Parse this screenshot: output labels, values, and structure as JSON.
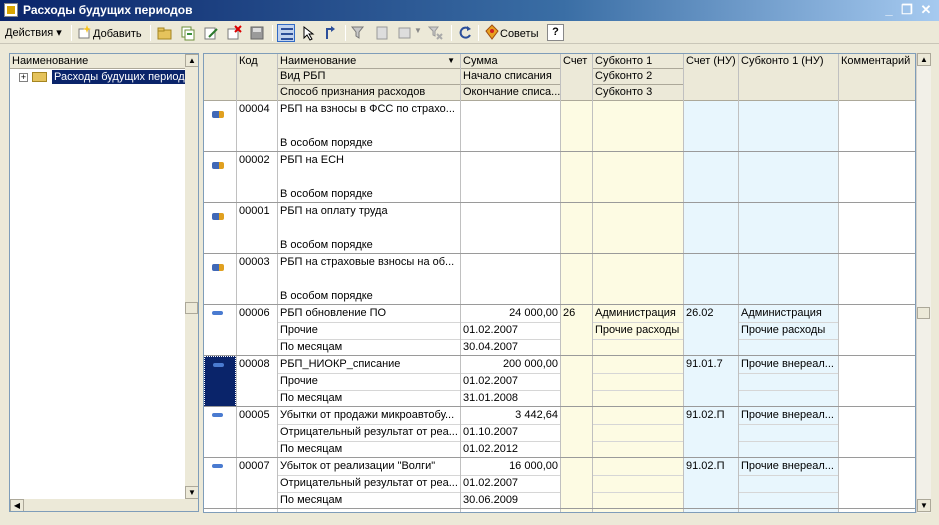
{
  "window": {
    "title": "Расходы будущих периодов"
  },
  "toolbar": {
    "actions_label": "Действия",
    "add_label": "Добавить",
    "tips_label": "Советы",
    "help_label": "?"
  },
  "tree": {
    "header": "Наименование",
    "root_label": "Расходы будущих период"
  },
  "grid": {
    "headers": {
      "code": "Код",
      "name": "Наименование",
      "kind": "Вид РБП",
      "method": "Способ признания расходов",
      "sum": "Сумма",
      "start": "Начало списания",
      "end": "Окончание списа...",
      "account": "Счет",
      "subconto1": "Субконто 1",
      "subconto2": "Субконто 2",
      "subconto3": "Субконто 3",
      "account_nu": "Счет (НУ)",
      "subconto1_nu": "Субконто 1 (НУ)",
      "comment": "Комментарий"
    },
    "rows": [
      {
        "type": "folder",
        "code": "00004",
        "name": "РБП на взносы в ФСС по страхо...",
        "kind": "",
        "method": "В особом порядке",
        "sum": "",
        "start": "",
        "end": "",
        "account": "",
        "sub1": "",
        "sub2": "",
        "acc_nu": "",
        "sub1_nu": "",
        "sub2_nu": "",
        "comment": ""
      },
      {
        "type": "folder",
        "code": "00002",
        "name": "РБП на ЕСН",
        "kind": "",
        "method": "В особом порядке",
        "sum": "",
        "start": "",
        "end": "",
        "account": "",
        "sub1": "",
        "sub2": "",
        "acc_nu": "",
        "sub1_nu": "",
        "sub2_nu": "",
        "comment": ""
      },
      {
        "type": "folder",
        "code": "00001",
        "name": "РБП на оплату труда",
        "kind": "",
        "method": "В особом порядке",
        "sum": "",
        "start": "",
        "end": "",
        "account": "",
        "sub1": "",
        "sub2": "",
        "acc_nu": "",
        "sub1_nu": "",
        "sub2_nu": "",
        "comment": ""
      },
      {
        "type": "folder",
        "code": "00003",
        "name": "РБП на страховые взносы на об...",
        "kind": "",
        "method": "В особом порядке",
        "sum": "",
        "start": "",
        "end": "",
        "account": "",
        "sub1": "",
        "sub2": "",
        "acc_nu": "",
        "sub1_nu": "",
        "sub2_nu": "",
        "comment": ""
      },
      {
        "type": "item",
        "code": "00006",
        "name": "РБП обновление ПО",
        "kind": "Прочие",
        "method": "По месяцам",
        "sum": "24 000,00",
        "start": "01.02.2007",
        "end": "30.04.2007",
        "account": "26",
        "sub1": "Администрация",
        "sub2": "Прочие расходы",
        "acc_nu": "26.02",
        "sub1_nu": "Администрация",
        "sub2_nu": "Прочие расходы",
        "comment": ""
      },
      {
        "type": "item",
        "code": "00008",
        "name": "РБП_НИОКР_списание",
        "kind": "Прочие",
        "method": "По месяцам",
        "sum": "200 000,00",
        "start": "01.02.2007",
        "end": "31.01.2008",
        "account": "",
        "sub1": "",
        "sub2": "",
        "acc_nu": "91.01.7",
        "sub1_nu": "Прочие внереал...",
        "sub2_nu": "",
        "comment": "",
        "selected": true
      },
      {
        "type": "item",
        "code": "00005",
        "name": "Убытки от продажи микроавтобу...",
        "kind": "Отрицательный результат от реа...",
        "method": "По месяцам",
        "sum": "3 442,64",
        "start": "01.10.2007",
        "end": "01.02.2012",
        "account": "",
        "sub1": "",
        "sub2": "",
        "acc_nu": "91.02.П",
        "sub1_nu": "Прочие внереал...",
        "sub2_nu": "",
        "comment": ""
      },
      {
        "type": "item",
        "code": "00007",
        "name": "Убыток от реализации \"Волги\"",
        "kind": "Отрицательный результат от реа...",
        "method": "По месяцам",
        "sum": "16 000,00",
        "start": "01.02.2007",
        "end": "30.06.2009",
        "account": "",
        "sub1": "",
        "sub2": "",
        "acc_nu": "91.02.П",
        "sub1_nu": "Прочие внереал...",
        "sub2_nu": "",
        "comment": ""
      }
    ]
  },
  "colors": {
    "title_start": "#0a246a",
    "title_end": "#a6caf0",
    "account_col": "#fdfbe3",
    "nu_col": "#e8f6fd",
    "selection": "#0a246a"
  },
  "icons": [
    "window-icon",
    "minimize-icon",
    "restore-icon",
    "close-icon",
    "add-icon",
    "folder-add-icon",
    "copy-icon",
    "edit-icon",
    "delete-icon",
    "save-icon",
    "hierarchy-icon",
    "select-icon",
    "move-up-icon",
    "filter-icon",
    "filter-set-icon",
    "filter-menu-icon",
    "filter-clear-icon",
    "refresh-icon",
    "tips-icon",
    "help-icon"
  ]
}
